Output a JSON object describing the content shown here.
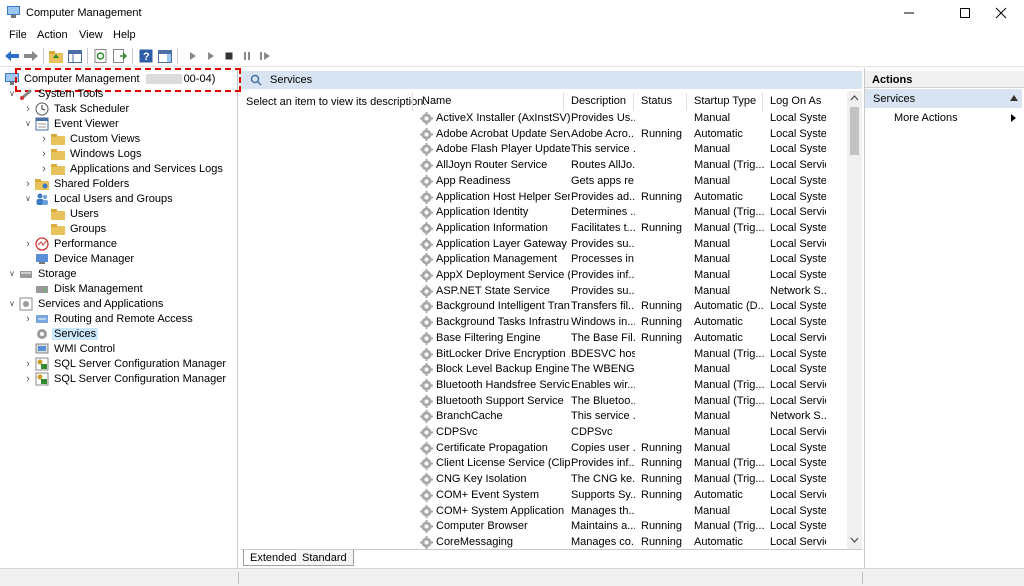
{
  "window": {
    "title": "Computer Management",
    "controls": [
      "minimize-icon",
      "maximize-icon",
      "close-icon"
    ]
  },
  "menu": {
    "items": [
      "File",
      "Action",
      "View",
      "Help"
    ]
  },
  "toolbar": {
    "icons": [
      "back-arrow-icon",
      "forward-arrow-icon",
      "up-folder-icon",
      "show-hide-tree-icon",
      "refresh-icon",
      "export-list-icon",
      "help-icon",
      "show-action-pane-icon",
      "start-service-icon",
      "play-icon",
      "stop-icon",
      "pause-icon",
      "restart-icon"
    ]
  },
  "tree": {
    "root_label": "Computer Management",
    "root_suffix": "00-04)",
    "items": [
      {
        "label": "System Tools",
        "level": 1,
        "caret": "open"
      },
      {
        "label": "Task Scheduler",
        "level": 2,
        "caret": "closed"
      },
      {
        "label": "Event Viewer",
        "level": 2,
        "caret": "open"
      },
      {
        "label": "Custom Views",
        "level": 3,
        "caret": "closed"
      },
      {
        "label": "Windows Logs",
        "level": 3,
        "caret": "closed"
      },
      {
        "label": "Applications and Services Logs",
        "level": 3,
        "caret": "closed"
      },
      {
        "label": "Shared Folders",
        "level": 2,
        "caret": "closed"
      },
      {
        "label": "Local Users and Groups",
        "level": 2,
        "caret": "open"
      },
      {
        "label": "Users",
        "level": 3,
        "caret": "none"
      },
      {
        "label": "Groups",
        "level": 3,
        "caret": "none"
      },
      {
        "label": "Performance",
        "level": 2,
        "caret": "closed"
      },
      {
        "label": "Device Manager",
        "level": 2,
        "caret": "none"
      },
      {
        "label": "Storage",
        "level": 1,
        "caret": "open"
      },
      {
        "label": "Disk Management",
        "level": 2,
        "caret": "none"
      },
      {
        "label": "Services and Applications",
        "level": 1,
        "caret": "open"
      },
      {
        "label": "Routing and Remote Access",
        "level": 2,
        "caret": "closed"
      },
      {
        "label": "Services",
        "level": 2,
        "caret": "none",
        "selected": true
      },
      {
        "label": "WMI Control",
        "level": 2,
        "caret": "none"
      },
      {
        "label": "SQL Server Configuration Manager",
        "level": 2,
        "caret": "closed"
      },
      {
        "label": "SQL Server Configuration Manager",
        "level": 2,
        "caret": "closed"
      }
    ]
  },
  "services_panel": {
    "header": "Services",
    "description_prompt": "Select an item to view its description.",
    "columns": [
      "Name",
      "Description",
      "Status",
      "Startup Type",
      "Log On As"
    ],
    "rows": [
      [
        "ActiveX Installer (AxInstSV)",
        "Provides Us...",
        "",
        "Manual",
        "Local Syste..."
      ],
      [
        "Adobe Acrobat Update Serv...",
        "Adobe Acro...",
        "Running",
        "Automatic",
        "Local Syste..."
      ],
      [
        "Adobe Flash Player Update ...",
        "This service ...",
        "",
        "Manual",
        "Local Syste..."
      ],
      [
        "AllJoyn Router Service",
        "Routes AllJo...",
        "",
        "Manual (Trig...",
        "Local Service"
      ],
      [
        "App Readiness",
        "Gets apps re...",
        "",
        "Manual",
        "Local Syste..."
      ],
      [
        "Application Host Helper Ser...",
        "Provides ad...",
        "Running",
        "Automatic",
        "Local Syste..."
      ],
      [
        "Application Identity",
        "Determines ...",
        "",
        "Manual (Trig...",
        "Local Service"
      ],
      [
        "Application Information",
        "Facilitates t...",
        "Running",
        "Manual (Trig...",
        "Local Syste..."
      ],
      [
        "Application Layer Gateway ...",
        "Provides su...",
        "",
        "Manual",
        "Local Service"
      ],
      [
        "Application Management",
        "Processes in...",
        "",
        "Manual",
        "Local Syste..."
      ],
      [
        "AppX Deployment Service (...",
        "Provides inf...",
        "",
        "Manual",
        "Local Syste..."
      ],
      [
        "ASP.NET State Service",
        "Provides su...",
        "",
        "Manual",
        "Network S..."
      ],
      [
        "Background Intelligent Tran...",
        "Transfers fil...",
        "Running",
        "Automatic (D...",
        "Local Syste..."
      ],
      [
        "Background Tasks Infrastru...",
        "Windows in...",
        "Running",
        "Automatic",
        "Local Syste..."
      ],
      [
        "Base Filtering Engine",
        "The Base Fil...",
        "Running",
        "Automatic",
        "Local Service"
      ],
      [
        "BitLocker Drive Encryption ...",
        "BDESVC hos...",
        "",
        "Manual (Trig...",
        "Local Syste..."
      ],
      [
        "Block Level Backup Engine ...",
        "The WBENG...",
        "",
        "Manual",
        "Local Syste..."
      ],
      [
        "Bluetooth Handsfree Service",
        "Enables wir...",
        "",
        "Manual (Trig...",
        "Local Service"
      ],
      [
        "Bluetooth Support Service",
        "The Bluetoo...",
        "",
        "Manual (Trig...",
        "Local Service"
      ],
      [
        "BranchCache",
        "This service ...",
        "",
        "Manual",
        "Network S..."
      ],
      [
        "CDPSvc",
        "CDPSvc",
        "",
        "Manual",
        "Local Service"
      ],
      [
        "Certificate Propagation",
        "Copies user ...",
        "Running",
        "Manual",
        "Local Syste..."
      ],
      [
        "Client License Service (ClipS...",
        "Provides inf...",
        "Running",
        "Manual (Trig...",
        "Local Syste..."
      ],
      [
        "CNG Key Isolation",
        "The CNG ke...",
        "Running",
        "Manual (Trig...",
        "Local Syste..."
      ],
      [
        "COM+ Event System",
        "Supports Sy...",
        "Running",
        "Automatic",
        "Local Service"
      ],
      [
        "COM+ System Application",
        "Manages th...",
        "",
        "Manual",
        "Local Syste..."
      ],
      [
        "Computer Browser",
        "Maintains a...",
        "Running",
        "Manual (Trig...",
        "Local Syste..."
      ],
      [
        "CoreMessaging",
        "Manages co...",
        "Running",
        "Automatic",
        "Local Service"
      ]
    ],
    "tabs": [
      "Extended",
      "Standard"
    ]
  },
  "actions_panel": {
    "title": "Actions",
    "section": "Services",
    "items": [
      "More Actions"
    ]
  },
  "colors": {
    "header_blue": "#d8e4f2",
    "selected": "#cce8ff",
    "highlight_border": "#e00000"
  }
}
